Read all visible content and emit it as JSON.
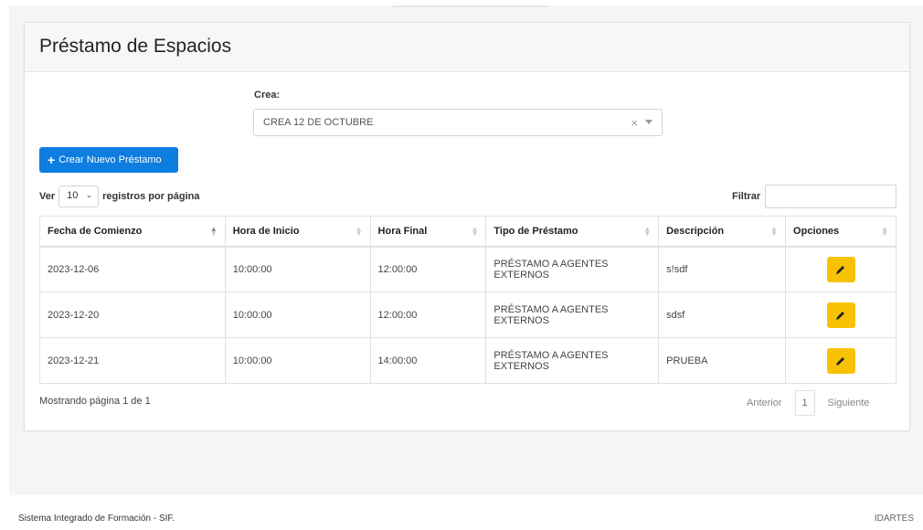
{
  "page": {
    "title": "Préstamo de Espacios"
  },
  "crea": {
    "label": "Crea:",
    "selected": "CREA 12 DE OCTUBRE",
    "clear": "×"
  },
  "actions": {
    "new_loan": "Crear Nuevo Préstamo"
  },
  "length": {
    "prefix": "Ver",
    "value": "10",
    "suffix": "registros por página"
  },
  "filter": {
    "label": "Filtrar",
    "value": ""
  },
  "table": {
    "headers": [
      "Fecha de Comienzo",
      "Hora de Inicio",
      "Hora Final",
      "Tipo de Préstamo",
      "Descripción",
      "Opciones"
    ],
    "rows": [
      {
        "fecha": "2023-12-06",
        "inicio": "10:00:00",
        "final": "12:00:00",
        "tipo": "PRÉSTAMO A AGENTES EXTERNOS",
        "descripcion": "s!sdf"
      },
      {
        "fecha": "2023-12-20",
        "inicio": "10:00:00",
        "final": "12:00:00",
        "tipo": "PRÉSTAMO A AGENTES EXTERNOS",
        "descripcion": "sdsf"
      },
      {
        "fecha": "2023-12-21",
        "inicio": "10:00:00",
        "final": "14:00:00",
        "tipo": "PRÉSTAMO A AGENTES EXTERNOS",
        "descripcion": "PRUEBA"
      }
    ]
  },
  "pagination": {
    "info": "Mostrando página 1 de 1",
    "previous": "Anterior",
    "page": "1",
    "next": "Siguiente"
  },
  "footer": {
    "left": "Sistema Integrado de Formación - SIF.",
    "right": "IDARTES"
  },
  "colors": {
    "primary": "#0d7de0",
    "edit": "#f7c204"
  }
}
